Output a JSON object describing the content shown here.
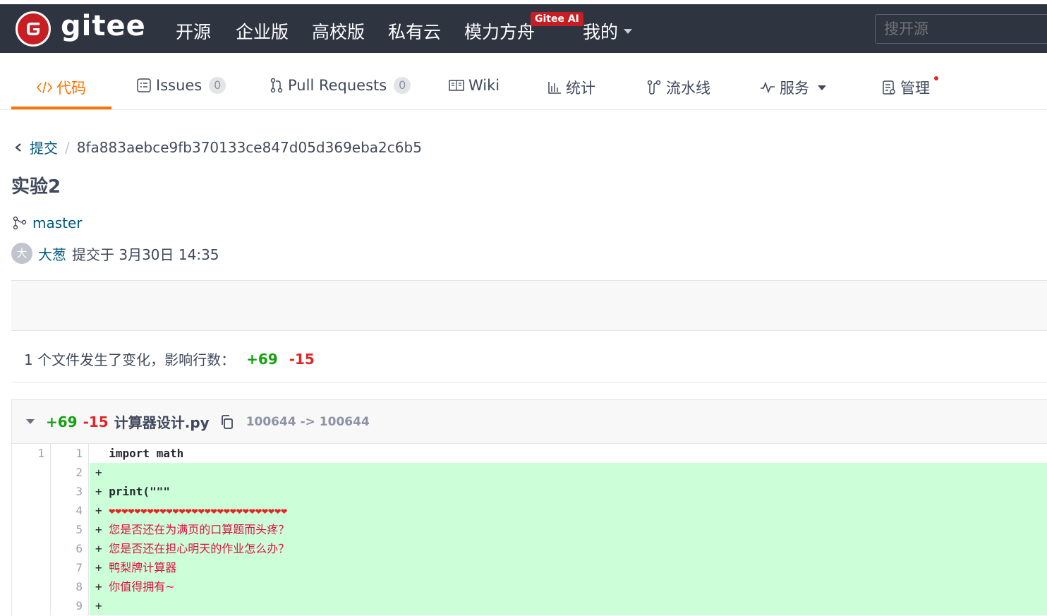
{
  "topbar": {
    "brand": "gitee",
    "nav": [
      "开源",
      "企业版",
      "高校版",
      "私有云",
      "模力方舟",
      "我的"
    ],
    "ai_badge": "Gitee AI",
    "search_placeholder": "搜开源"
  },
  "tabs": {
    "code": "代码",
    "issues": "Issues",
    "issues_count": "0",
    "pull_requests": "Pull Requests",
    "pr_count": "0",
    "wiki": "Wiki",
    "stats": "统计",
    "pipeline": "流水线",
    "services": "服务",
    "manage": "管理"
  },
  "commit": {
    "back_label": "提交",
    "hash": "8fa883aebce9fb370133ce847d05d369eba2c6b5",
    "title": "实验2",
    "branch": "master",
    "avatar_initial": "大",
    "author": "大葱",
    "submitted_at": "提交于 3月30日 14:35"
  },
  "summary": {
    "text": "1 个文件发生了变化，影响行数：",
    "additions": "+69",
    "deletions": "-15"
  },
  "file": {
    "additions": "+69",
    "deletions": "-15",
    "name": "计算器设计.py",
    "mode": "100644 -> 100644",
    "lines": [
      {
        "old": "1",
        "new": "1",
        "marker": " ",
        "text": "import math",
        "add": false
      },
      {
        "old": "",
        "new": "2",
        "marker": "+",
        "text": "",
        "add": true
      },
      {
        "old": "",
        "new": "3",
        "marker": "+",
        "text": "print(\"\"\"",
        "add": true
      },
      {
        "old": "",
        "new": "4",
        "marker": "+",
        "text": "❤❤❤❤❤❤❤❤❤❤❤❤❤❤❤❤❤❤❤❤❤❤❤❤❤❤❤❤",
        "add": true
      },
      {
        "old": "",
        "new": "5",
        "marker": "+",
        "text": "您是否还在为满页的口算题而头疼？",
        "add": true
      },
      {
        "old": "",
        "new": "6",
        "marker": "+",
        "text": "您是否还在担心明天的作业怎么办？",
        "add": true
      },
      {
        "old": "",
        "new": "7",
        "marker": "+",
        "text": "鸭梨牌计算器",
        "add": true
      },
      {
        "old": "",
        "new": "8",
        "marker": "+",
        "text": "你值得拥有~",
        "add": true
      },
      {
        "old": "",
        "new": "9",
        "marker": "+",
        "text": "",
        "add": true
      }
    ]
  }
}
